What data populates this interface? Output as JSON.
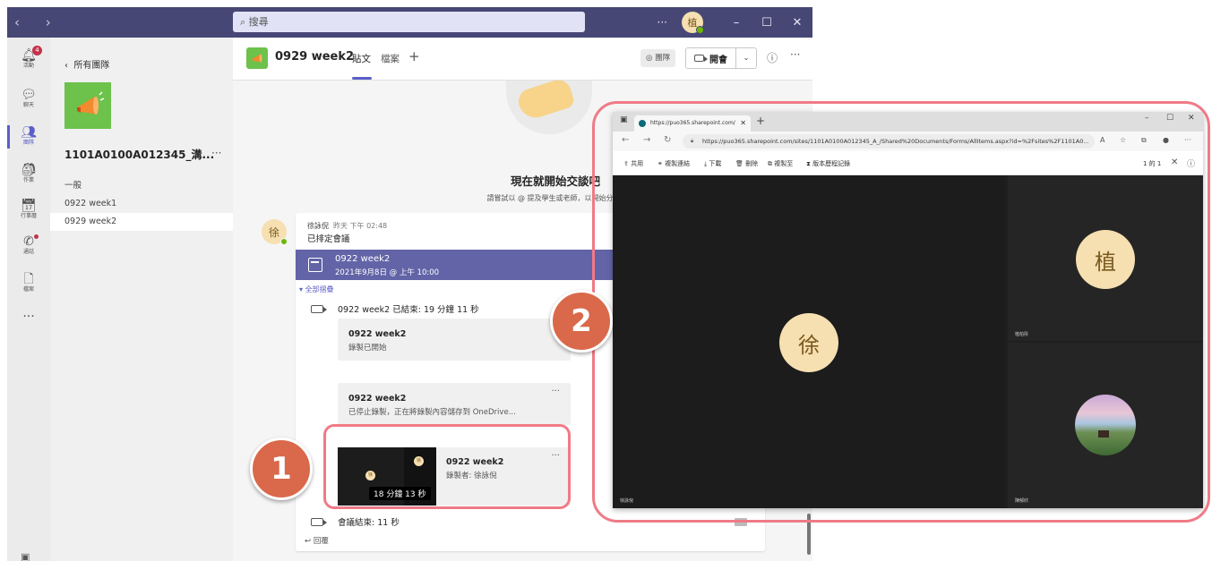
{
  "teams": {
    "titlebar": {
      "nav_arrows": "‹ ›",
      "search_placeholder": "搜尋",
      "more": "···",
      "avatar_initial": "植"
    },
    "window_controls": {
      "minimize": "–",
      "maximize": "☐",
      "close": "✕"
    },
    "rail": [
      {
        "label": "活動",
        "icon": "bell-icon",
        "badge": "4"
      },
      {
        "label": "聊天",
        "icon": "chat-icon"
      },
      {
        "label": "團隊",
        "icon": "teams-icon",
        "active": true
      },
      {
        "label": "作業",
        "icon": "assignments-icon"
      },
      {
        "label": "行事曆",
        "icon": "calendar-icon"
      },
      {
        "label": "通話",
        "icon": "phone-icon"
      },
      {
        "label": "檔案",
        "icon": "file-icon"
      },
      {
        "label": "···",
        "icon": "more-apps-icon"
      }
    ],
    "sidepanel": {
      "back_label": "所有團隊",
      "team_name": "1101A0100A012345_溝...",
      "team_more": "···",
      "channels": [
        "一般",
        "0922 week1",
        "0929 week2"
      ],
      "active_channel": 2
    },
    "channel_header": {
      "title": "0929 week2",
      "tabs": [
        "貼文",
        "檔案"
      ],
      "add_tab": "+",
      "team_button": "團隊",
      "meet_button": "開會",
      "info": "ⓘ",
      "more": "···"
    },
    "empty_state": {
      "title": "現在就開始交談吧",
      "subtitle": "請嘗試以 @ 提及學生或老師，以開始分享想法。"
    },
    "post": {
      "avatar_initial": "徐",
      "author": "徐詠倪",
      "time": "昨天 下午 02:48",
      "message": "已排定會議",
      "meeting": {
        "title": "0922 week2",
        "datetime": "2021年9月8日 @ 上午 10:00"
      },
      "collapse_all": "全部摺疊",
      "ended_text": "0922 week2 已結束: 19 分鐘 11 秒",
      "card1": {
        "title": "0922 week2",
        "subtitle": "錄製已開始"
      },
      "card2": {
        "title": "0922 week2",
        "subtitle": "已停止錄製，正在將錄製內容儲存到 OneDrive...",
        "more": "···"
      },
      "recording": {
        "title": "0922 week2",
        "recorded_by": "錄製者: 徐詠倪",
        "duration": "18 分鐘 13 秒",
        "more": "···",
        "thumb_initial": "徐"
      },
      "meeting_end": "會議結束: 11 秒",
      "reply": "回覆"
    }
  },
  "annotations": {
    "one": "1",
    "two": "2"
  },
  "browser": {
    "tab_title": "https://puo365.sharepoint.com/",
    "tab_close": "✕",
    "new_tab": "+",
    "controls": {
      "minimize": "–",
      "maximize": "☐",
      "close": "✕"
    },
    "nav": {
      "back": "←",
      "forward": "→",
      "refresh": "↻"
    },
    "url": "https://puo365.sharepoint.com/sites/1101A0100A012345_A_/Shared%20Documents/Forms/AllItems.aspx?id=%2Fsites%2F1101A0...",
    "commands": [
      "共用",
      "複製連結",
      "下載",
      "刪除",
      "複製至",
      "版本歷程記錄"
    ],
    "page_indicator": "1 的 1",
    "close": "✕",
    "info": "ⓘ",
    "video": {
      "main_initial": "徐",
      "top_right_initial": "植",
      "main_label": "徐詠倪",
      "top_right_label": "植柏彤",
      "bottom_right_label": "陳郁欣"
    }
  },
  "colors": {
    "teams_purple": "#464775",
    "accent": "#5b5fc7",
    "meeting_banner": "#6264a7",
    "highlight": "#f07a86",
    "badge_circle": "#d9694a"
  }
}
